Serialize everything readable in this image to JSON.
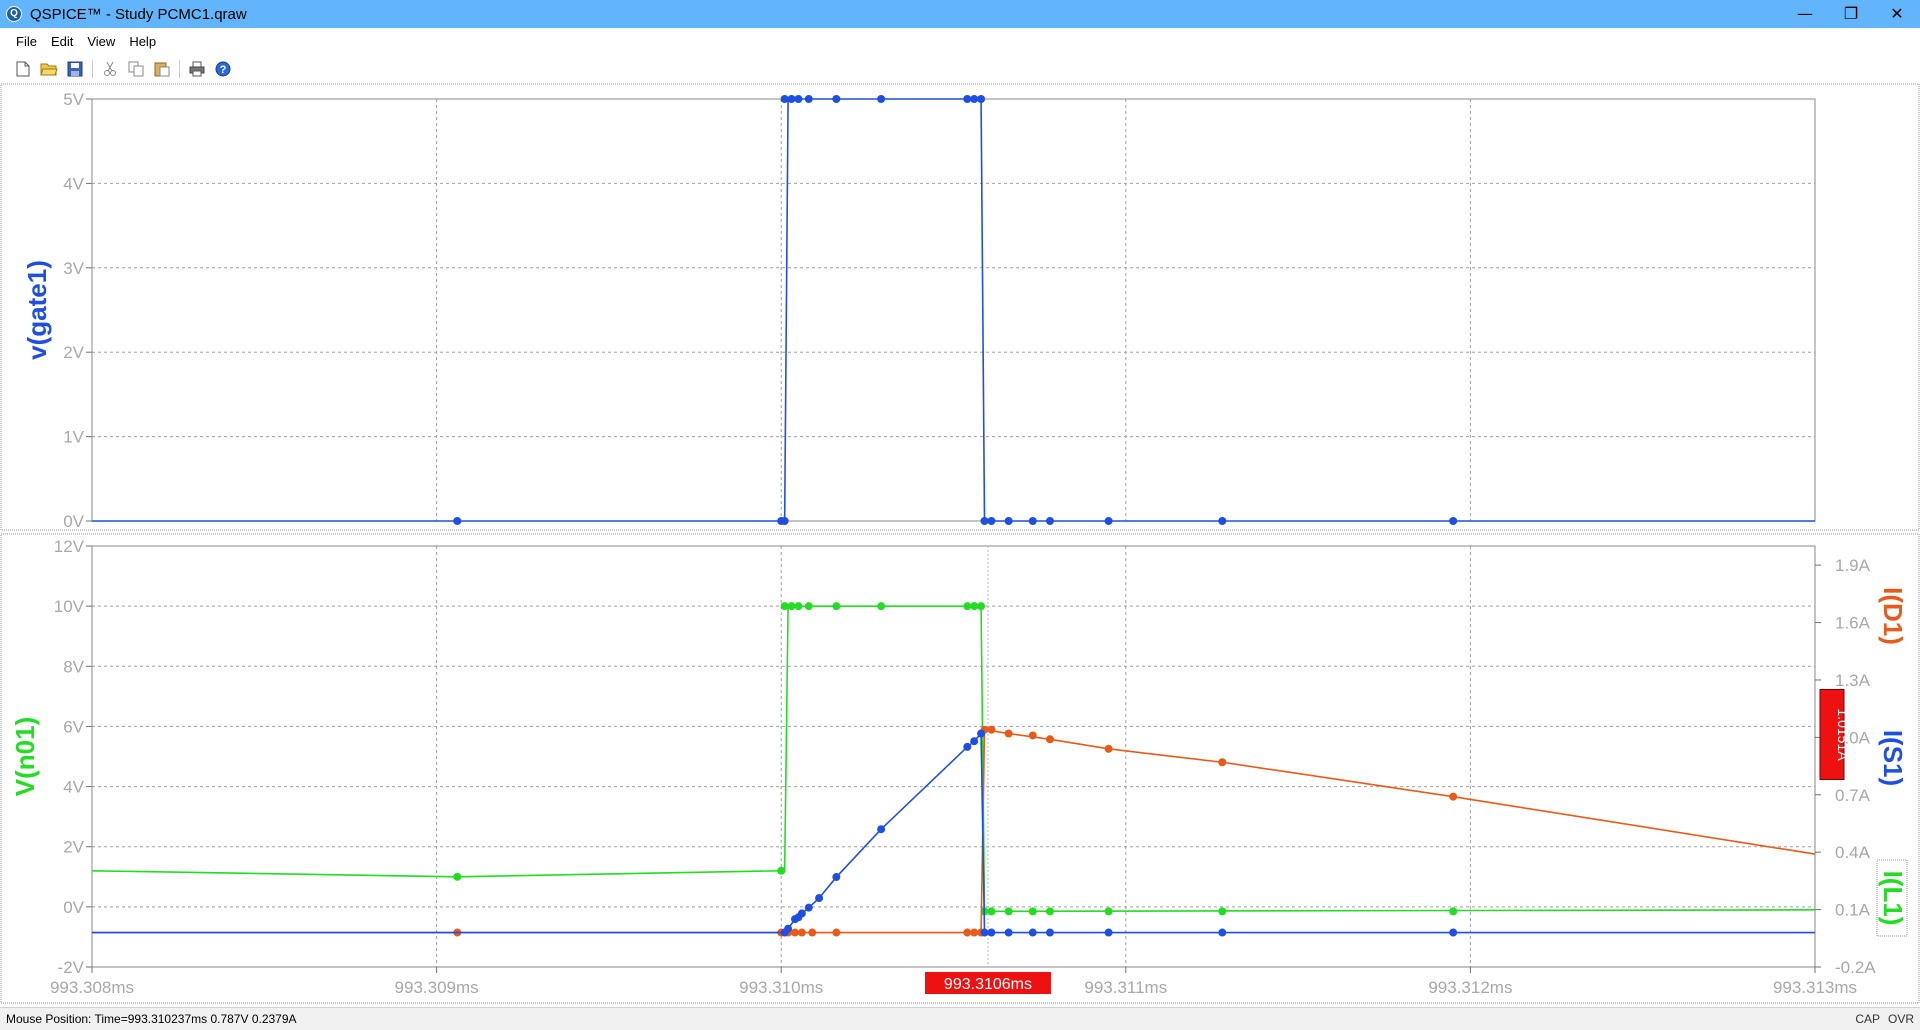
{
  "window": {
    "title": "QSPICE™ - Study PCMC1.qraw",
    "app_icon": "Q",
    "minimize_icon": "minimize-icon",
    "restore_icon": "restore-icon",
    "close_icon": "close-icon"
  },
  "menu": [
    "File",
    "Edit",
    "View",
    "Help"
  ],
  "toolbar": [
    "new-file-icon",
    "open-folder-icon",
    "save-icon",
    "cut-icon",
    "copy-icon",
    "paste-icon",
    "print-icon",
    "help-icon"
  ],
  "colors": {
    "gate": "#1f4fe0",
    "n01": "#22dd22",
    "id1": "#e85a1a",
    "is1": "#1f4fe0",
    "il1": "#22dd22",
    "grid": "#a0a0a0",
    "tick_text": "#a8a8a8",
    "marker": "#ee1111"
  },
  "chart_data": [
    {
      "type": "line",
      "pane": "top",
      "xlim": [
        993.308,
        993.313
      ],
      "x_unit": "ms",
      "grid": true,
      "left_axis": {
        "label": "v(gate1)",
        "ylim": [
          0,
          5
        ],
        "ticks": [
          0,
          1,
          2,
          3,
          4,
          5
        ],
        "tick_labels": [
          "0V",
          "1V",
          "2V",
          "3V",
          "4V",
          "5V"
        ]
      },
      "series": [
        {
          "name": "v(gate1)",
          "axis": "left",
          "color_key": "gate",
          "points": [
            [
              993.308,
              0
            ],
            [
              993.30906,
              0
            ],
            [
              993.31,
              0
            ],
            [
              993.31001,
              0
            ],
            [
              993.31002,
              5
            ],
            [
              993.31004,
              5
            ],
            [
              993.31006,
              5
            ],
            [
              993.31009,
              5
            ],
            [
              993.31016,
              5
            ],
            [
              993.31029,
              5
            ],
            [
              993.31055,
              5
            ],
            [
              993.31056,
              5
            ],
            [
              993.31058,
              5
            ],
            [
              993.31059,
              0
            ],
            [
              993.31061,
              0
            ],
            [
              993.31065,
              0
            ],
            [
              993.31071,
              0
            ],
            [
              993.31078,
              0
            ],
            [
              993.31095,
              0
            ],
            [
              993.31128,
              0
            ],
            [
              993.31195,
              0
            ],
            [
              993.313,
              0
            ]
          ],
          "markers": [
            [
              993.30906,
              0
            ],
            [
              993.31,
              0
            ],
            [
              993.31001,
              0
            ],
            [
              993.31001,
              5
            ],
            [
              993.31003,
              5
            ],
            [
              993.31005,
              5
            ],
            [
              993.31008,
              5
            ],
            [
              993.31016,
              5
            ],
            [
              993.31029,
              5
            ],
            [
              993.31054,
              5
            ],
            [
              993.31056,
              5
            ],
            [
              993.31058,
              5
            ],
            [
              993.31059,
              0
            ],
            [
              993.31061,
              0
            ],
            [
              993.31066,
              0
            ],
            [
              993.31073,
              0
            ],
            [
              993.31078,
              0
            ],
            [
              993.31095,
              0
            ],
            [
              993.31128,
              0
            ],
            [
              993.31195,
              0
            ]
          ]
        }
      ]
    },
    {
      "type": "line",
      "pane": "bottom",
      "xlim": [
        993.308,
        993.313
      ],
      "x_unit": "ms",
      "grid": true,
      "x_ticks": [
        993.308,
        993.309,
        993.31,
        993.311,
        993.312,
        993.313
      ],
      "x_tick_labels": [
        "993.308ms",
        "993.309ms",
        "993.310ms",
        "993.311ms",
        "993.312ms",
        "993.313ms"
      ],
      "left_axis": {
        "label": "V(n01)",
        "ylim": [
          -2,
          12
        ],
        "ticks": [
          -2,
          0,
          2,
          4,
          6,
          8,
          10,
          12
        ],
        "tick_labels": [
          "-2V",
          "0V",
          "2V",
          "4V",
          "6V",
          "8V",
          "10V",
          "12V"
        ]
      },
      "right_axis": {
        "labels": [
          "I(D1)",
          "I(S1)",
          "I(L1)"
        ],
        "ylim": [
          -0.2,
          2.0
        ],
        "ticks": [
          -0.2,
          0.1,
          0.4,
          0.7,
          1.0,
          1.3,
          1.6,
          1.9
        ],
        "tick_labels": [
          "-0.2A",
          "0.1A",
          "0.4A",
          "0.7A",
          "1.0A",
          "1.3A",
          "1.6A",
          "1.9A"
        ]
      },
      "cursor": {
        "x": 993.3106,
        "x_label": "993.3106ms",
        "y_label": "1.0151A"
      },
      "series": [
        {
          "name": "V(n01)",
          "axis": "left",
          "color_key": "n01",
          "points": [
            [
              993.308,
              1.2
            ],
            [
              993.30906,
              1.0
            ],
            [
              993.31,
              1.2
            ],
            [
              993.31001,
              1.2
            ],
            [
              993.31002,
              10
            ],
            [
              993.31058,
              10
            ],
            [
              993.31059,
              -0.15
            ],
            [
              993.313,
              -0.1
            ]
          ],
          "markers": [
            [
              993.30906,
              1.0
            ],
            [
              993.31,
              1.2
            ],
            [
              993.31001,
              10
            ],
            [
              993.31003,
              10
            ],
            [
              993.31005,
              10
            ],
            [
              993.31008,
              10
            ],
            [
              993.31016,
              10
            ],
            [
              993.31029,
              10
            ],
            [
              993.31054,
              10
            ],
            [
              993.31056,
              10
            ],
            [
              993.31058,
              10
            ],
            [
              993.31059,
              -0.15
            ],
            [
              993.31061,
              -0.15
            ],
            [
              993.31066,
              -0.15
            ],
            [
              993.31073,
              -0.15
            ],
            [
              993.31078,
              -0.15
            ],
            [
              993.31095,
              -0.15
            ],
            [
              993.31128,
              -0.15
            ],
            [
              993.31195,
              -0.15
            ]
          ]
        },
        {
          "name": "I(D1)",
          "axis": "right",
          "color_key": "id1",
          "points": [
            [
              993.308,
              -0.02
            ],
            [
              993.31058,
              -0.02
            ],
            [
              993.31059,
              1.04
            ],
            [
              993.31066,
              1.02
            ],
            [
              993.31078,
              0.99
            ],
            [
              993.31095,
              0.94
            ],
            [
              993.31128,
              0.87
            ],
            [
              993.31195,
              0.69
            ],
            [
              993.313,
              0.39
            ]
          ],
          "markers": [
            [
              993.30906,
              -0.02
            ],
            [
              993.31,
              -0.02
            ],
            [
              993.31002,
              -0.02
            ],
            [
              993.31004,
              -0.02
            ],
            [
              993.31006,
              -0.02
            ],
            [
              993.31009,
              -0.02
            ],
            [
              993.31016,
              -0.02
            ],
            [
              993.31054,
              -0.02
            ],
            [
              993.31056,
              -0.02
            ],
            [
              993.31058,
              -0.02
            ],
            [
              993.31059,
              1.04
            ],
            [
              993.31061,
              1.04
            ],
            [
              993.31066,
              1.02
            ],
            [
              993.31073,
              1.01
            ],
            [
              993.31078,
              0.99
            ],
            [
              993.31095,
              0.94
            ],
            [
              993.31128,
              0.87
            ],
            [
              993.31195,
              0.69
            ]
          ]
        },
        {
          "name": "I(S1)",
          "axis": "right",
          "color_key": "is1",
          "points": [
            [
              993.308,
              -0.02
            ],
            [
              993.31001,
              -0.02
            ],
            [
              993.31002,
              0.0
            ],
            [
              993.31004,
              0.05
            ],
            [
              993.31006,
              0.08
            ],
            [
              993.31008,
              0.11
            ],
            [
              993.31011,
              0.16
            ],
            [
              993.31016,
              0.27
            ],
            [
              993.31029,
              0.52
            ],
            [
              993.31054,
              0.95
            ],
            [
              993.31056,
              0.98
            ],
            [
              993.31058,
              1.02
            ],
            [
              993.31059,
              -0.02
            ],
            [
              993.313,
              -0.02
            ]
          ],
          "markers": [
            [
              993.31001,
              -0.02
            ],
            [
              993.31002,
              0.0
            ],
            [
              993.31004,
              0.05
            ],
            [
              993.31005,
              0.06
            ],
            [
              993.31006,
              0.08
            ],
            [
              993.31008,
              0.11
            ],
            [
              993.31011,
              0.16
            ],
            [
              993.31016,
              0.27
            ],
            [
              993.31029,
              0.52
            ],
            [
              993.31054,
              0.95
            ],
            [
              993.31056,
              0.98
            ],
            [
              993.31058,
              1.02
            ],
            [
              993.31059,
              -0.02
            ],
            [
              993.31061,
              -0.02
            ],
            [
              993.31066,
              -0.02
            ],
            [
              993.31073,
              -0.02
            ],
            [
              993.31078,
              -0.02
            ],
            [
              993.31095,
              -0.02
            ],
            [
              993.31128,
              -0.02
            ],
            [
              993.31195,
              -0.02
            ]
          ]
        }
      ]
    }
  ],
  "statusbar": {
    "mouse_position": "Mouse Position: Time=993.310237ms  0.787V 0.2379A",
    "cap": "CAP",
    "ovr": "OVR"
  }
}
